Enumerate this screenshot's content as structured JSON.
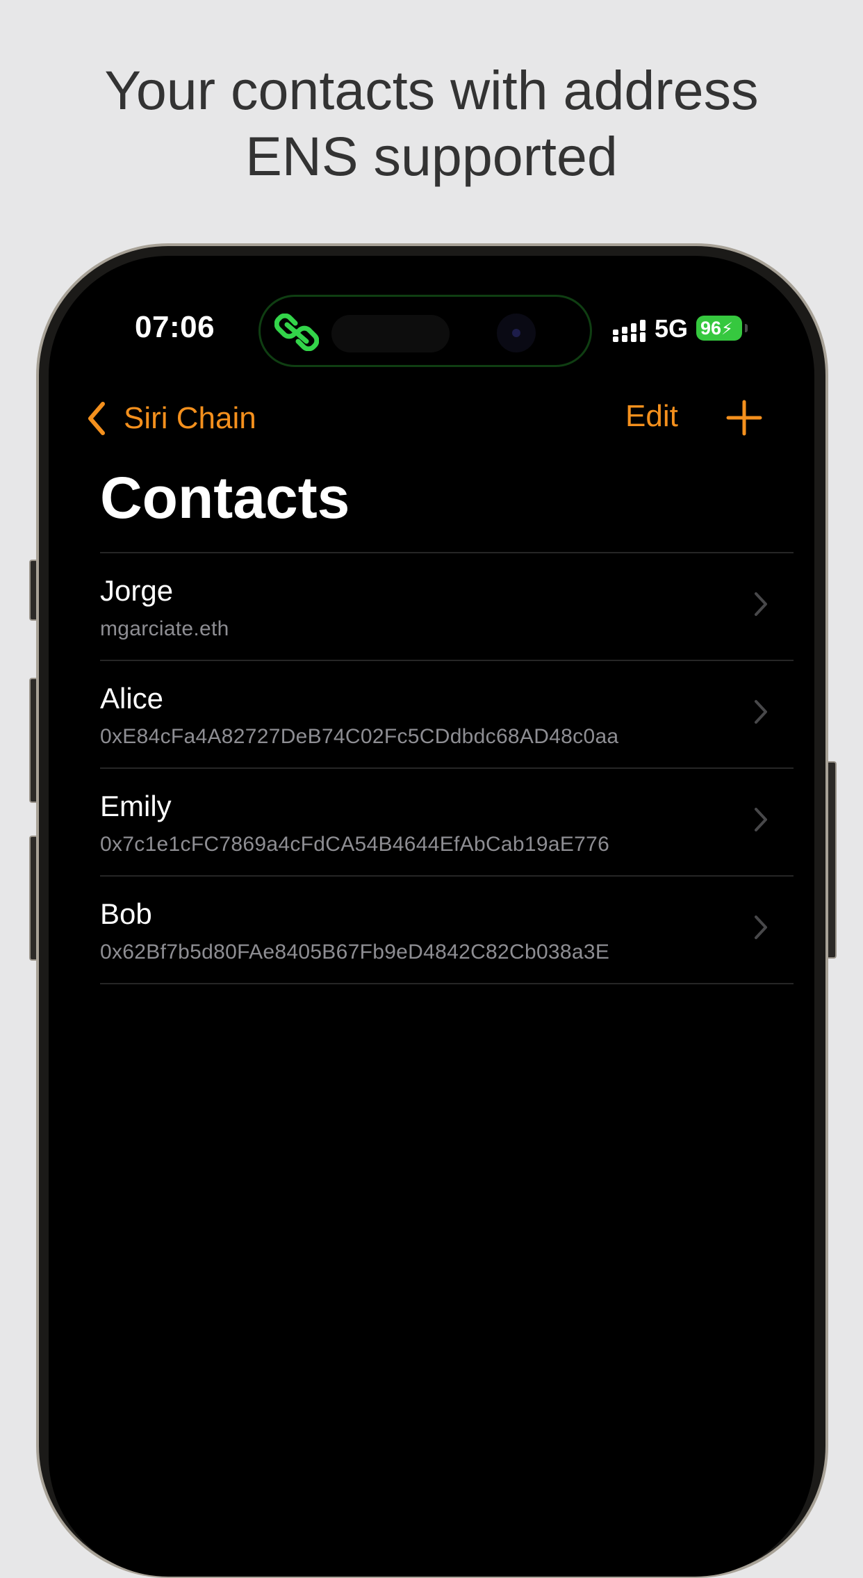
{
  "headline": {
    "line1": "Your contacts with address",
    "line2": "ENS supported"
  },
  "status_bar": {
    "time": "07:06",
    "network": "5G",
    "battery": "96",
    "island_icon": "link-chain-icon",
    "island_icon_color": "#33d44a"
  },
  "nav": {
    "back_label": "Siri Chain",
    "edit_label": "Edit",
    "add_icon": "plus-icon",
    "accent_color": "#f4901d"
  },
  "page": {
    "title": "Contacts"
  },
  "contacts": [
    {
      "name": "Jorge",
      "address": "mgarciate.eth"
    },
    {
      "name": "Alice",
      "address": "0xE84cFa4A82727DeB74C02Fc5CDdbdc68AD48c0aa"
    },
    {
      "name": "Emily",
      "address": "0x7c1e1cFC7869a4cFdCA54B4644EfAbCab19aE776"
    },
    {
      "name": "Bob",
      "address": "0x62Bf7b5d80FAe8405B67Fb9eD4842C82Cb038a3E"
    }
  ]
}
